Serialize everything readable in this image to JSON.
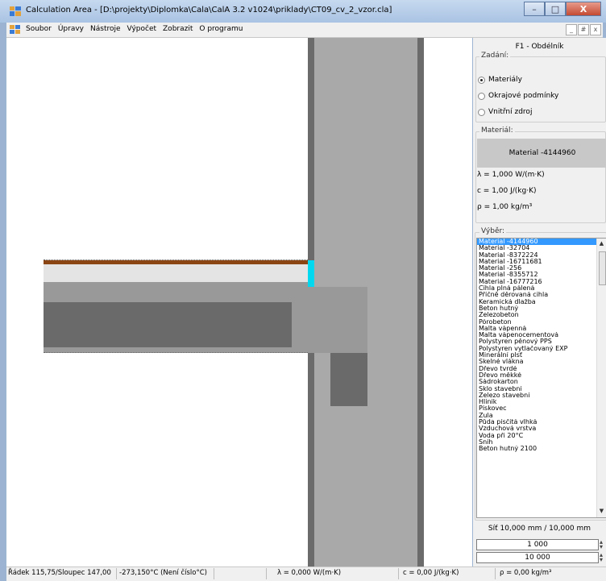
{
  "window": {
    "title": "Calculation Area - [D:\\projekty\\Diplomka\\Cala\\CalA 3.2 v1024\\priklady\\CT09_cv_2_vzor.cla]",
    "minimize_glyph": "–",
    "maximize_glyph": "□",
    "close_glyph": "X",
    "app_icon": "calculation-area-icon"
  },
  "menubar": {
    "items": [
      "Soubor",
      "Úpravy",
      "Nástroje",
      "Výpočet",
      "Zobrazit",
      "O programu"
    ],
    "mdi_min": "_",
    "mdi_restore": "#",
    "mdi_close": "x"
  },
  "canvas": {
    "colors": {
      "wall_outer": "#6b6b6b",
      "wall_inner": "#a9a9a9",
      "floor_brown": "#8b4513",
      "floor_light": "#e4e4e4",
      "slab_mid": "#999999",
      "slab_dark": "#6a6a6a",
      "highlight": "#00d8f0"
    }
  },
  "panel": {
    "title": "F1 - Obdélník",
    "zadani_label": "Zadání:",
    "radios": [
      {
        "label": "Materiály",
        "checked": true
      },
      {
        "label": "Okrajové podmínky",
        "checked": false
      },
      {
        "label": "Vnitřní zdroj",
        "checked": false
      }
    ],
    "material_label": "Materiál:",
    "material_name": "Material -4144960",
    "lambda": "λ = 1,000 W/(m·K)",
    "c": "c = 1,00 J/(kg·K)",
    "rho": "ρ = 1,00 kg/m³",
    "vyber_label": "Výběr:",
    "list": [
      "Material -4144960",
      "Material -32704",
      "Material -8372224",
      "Material -16711681",
      "Material -256",
      "Material -8355712",
      "Material -16777216",
      "Cihla plná pálená",
      "Příčně děrovaná cihla",
      "Keramická dlažba",
      "Beton hutný",
      "Železobeton",
      "Pórobeton",
      "Malta vápenná",
      "Malta vápenocementová",
      "Polystyren pěnový PPS",
      "Polystyren vytlačovaný EXP",
      "Minerální plsť",
      "Skelné vlákna",
      "Dřevo tvrdé",
      "Dřevo měkké",
      "Sádrokarton",
      "Sklo stavební",
      "Železo stavební",
      "Hliník",
      "Pískovec",
      "Žula",
      "Půda písčitá vlhká",
      "Vzduchová vrstva",
      "Voda při 20°C",
      "Sníh",
      "Beton hutný 2100"
    ],
    "selected_index": 0,
    "grid": "Síť 10,000 mm / 10,000 mm",
    "input1": "1 000",
    "input2": "10 000"
  },
  "status": {
    "position": "Řádek 115,75/Sloupec 147,00",
    "temperature": "-273,150°C (Není číslo°C)",
    "lambda": "λ = 0,000 W/(m·K)",
    "c": "c = 0,00 J/(kg·K)",
    "rho": "ρ = 0,00 kg/m³"
  }
}
